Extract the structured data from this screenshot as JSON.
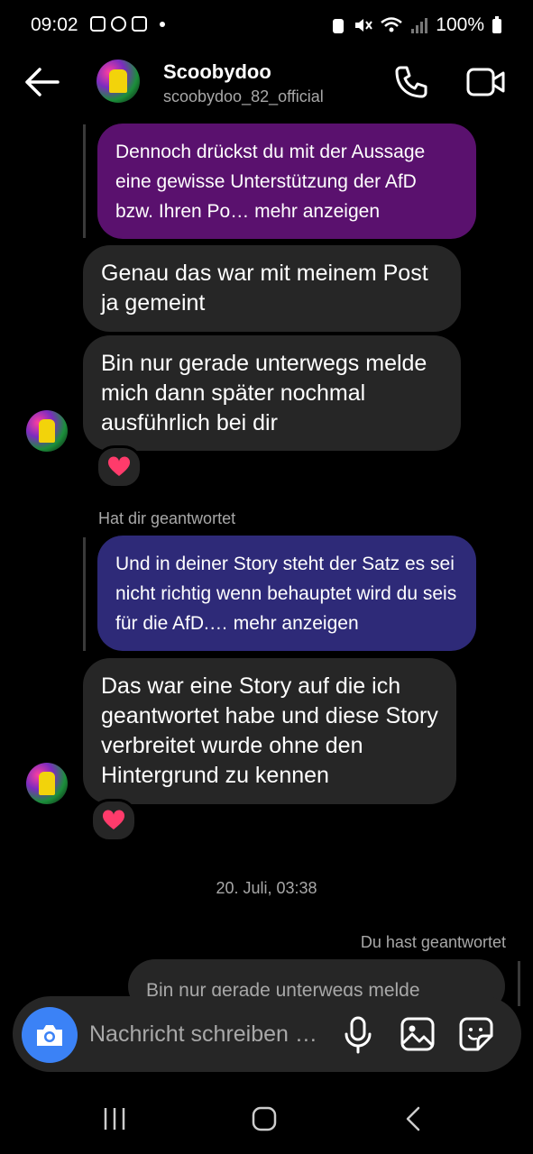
{
  "status_bar": {
    "time": "09:02",
    "battery": "100%"
  },
  "header": {
    "name": "Scoobydoo",
    "handle": "scoobydoo_82_official"
  },
  "messages": {
    "reply_1": "Dennoch drückst du mit der Aussage eine gewisse Unterstützung der AfD bzw. Ihren Po… mehr anzeigen",
    "msg_1": "Genau das war mit meinem Post ja gemeint",
    "msg_2": "Bin nur gerade unterwegs melde mich dann später nochmal ausführlich bei dir",
    "replied_label": "Hat dir geantwortet",
    "reply_2": "Und in deiner Story steht der Satz es sei nicht richtig wenn behauptet wird du seis für die AfD.… mehr anzeigen",
    "msg_3": "Das war eine Story auf die ich geantwortet habe und diese Story verbreitet wurde ohne den Hintergrund zu kennen",
    "timestamp": "20. Juli, 03:38",
    "you_replied_label": "Du hast geantwortet",
    "quoted_preview": "Bin nur gerade unterwegs melde"
  },
  "composer": {
    "placeholder": "Nachricht schreiben …"
  },
  "colors": {
    "accent_blue": "#3b82f6",
    "reply_purple": "#5a116e",
    "reply_indigo": "#2e2a78",
    "bubble_gray": "#262626"
  }
}
